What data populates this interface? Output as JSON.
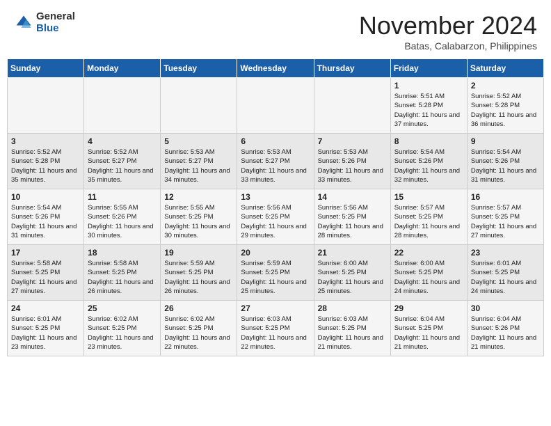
{
  "header": {
    "logo_general": "General",
    "logo_blue": "Blue",
    "month_title": "November 2024",
    "location": "Batas, Calabarzon, Philippines"
  },
  "weekdays": [
    "Sunday",
    "Monday",
    "Tuesday",
    "Wednesday",
    "Thursday",
    "Friday",
    "Saturday"
  ],
  "weeks": [
    [
      {
        "day": "",
        "sunrise": "",
        "sunset": "",
        "daylight": ""
      },
      {
        "day": "",
        "sunrise": "",
        "sunset": "",
        "daylight": ""
      },
      {
        "day": "",
        "sunrise": "",
        "sunset": "",
        "daylight": ""
      },
      {
        "day": "",
        "sunrise": "",
        "sunset": "",
        "daylight": ""
      },
      {
        "day": "",
        "sunrise": "",
        "sunset": "",
        "daylight": ""
      },
      {
        "day": "1",
        "sunrise": "Sunrise: 5:51 AM",
        "sunset": "Sunset: 5:28 PM",
        "daylight": "Daylight: 11 hours and 37 minutes."
      },
      {
        "day": "2",
        "sunrise": "Sunrise: 5:52 AM",
        "sunset": "Sunset: 5:28 PM",
        "daylight": "Daylight: 11 hours and 36 minutes."
      }
    ],
    [
      {
        "day": "3",
        "sunrise": "Sunrise: 5:52 AM",
        "sunset": "Sunset: 5:28 PM",
        "daylight": "Daylight: 11 hours and 35 minutes."
      },
      {
        "day": "4",
        "sunrise": "Sunrise: 5:52 AM",
        "sunset": "Sunset: 5:27 PM",
        "daylight": "Daylight: 11 hours and 35 minutes."
      },
      {
        "day": "5",
        "sunrise": "Sunrise: 5:53 AM",
        "sunset": "Sunset: 5:27 PM",
        "daylight": "Daylight: 11 hours and 34 minutes."
      },
      {
        "day": "6",
        "sunrise": "Sunrise: 5:53 AM",
        "sunset": "Sunset: 5:27 PM",
        "daylight": "Daylight: 11 hours and 33 minutes."
      },
      {
        "day": "7",
        "sunrise": "Sunrise: 5:53 AM",
        "sunset": "Sunset: 5:26 PM",
        "daylight": "Daylight: 11 hours and 33 minutes."
      },
      {
        "day": "8",
        "sunrise": "Sunrise: 5:54 AM",
        "sunset": "Sunset: 5:26 PM",
        "daylight": "Daylight: 11 hours and 32 minutes."
      },
      {
        "day": "9",
        "sunrise": "Sunrise: 5:54 AM",
        "sunset": "Sunset: 5:26 PM",
        "daylight": "Daylight: 11 hours and 31 minutes."
      }
    ],
    [
      {
        "day": "10",
        "sunrise": "Sunrise: 5:54 AM",
        "sunset": "Sunset: 5:26 PM",
        "daylight": "Daylight: 11 hours and 31 minutes."
      },
      {
        "day": "11",
        "sunrise": "Sunrise: 5:55 AM",
        "sunset": "Sunset: 5:26 PM",
        "daylight": "Daylight: 11 hours and 30 minutes."
      },
      {
        "day": "12",
        "sunrise": "Sunrise: 5:55 AM",
        "sunset": "Sunset: 5:25 PM",
        "daylight": "Daylight: 11 hours and 30 minutes."
      },
      {
        "day": "13",
        "sunrise": "Sunrise: 5:56 AM",
        "sunset": "Sunset: 5:25 PM",
        "daylight": "Daylight: 11 hours and 29 minutes."
      },
      {
        "day": "14",
        "sunrise": "Sunrise: 5:56 AM",
        "sunset": "Sunset: 5:25 PM",
        "daylight": "Daylight: 11 hours and 28 minutes."
      },
      {
        "day": "15",
        "sunrise": "Sunrise: 5:57 AM",
        "sunset": "Sunset: 5:25 PM",
        "daylight": "Daylight: 11 hours and 28 minutes."
      },
      {
        "day": "16",
        "sunrise": "Sunrise: 5:57 AM",
        "sunset": "Sunset: 5:25 PM",
        "daylight": "Daylight: 11 hours and 27 minutes."
      }
    ],
    [
      {
        "day": "17",
        "sunrise": "Sunrise: 5:58 AM",
        "sunset": "Sunset: 5:25 PM",
        "daylight": "Daylight: 11 hours and 27 minutes."
      },
      {
        "day": "18",
        "sunrise": "Sunrise: 5:58 AM",
        "sunset": "Sunset: 5:25 PM",
        "daylight": "Daylight: 11 hours and 26 minutes."
      },
      {
        "day": "19",
        "sunrise": "Sunrise: 5:59 AM",
        "sunset": "Sunset: 5:25 PM",
        "daylight": "Daylight: 11 hours and 26 minutes."
      },
      {
        "day": "20",
        "sunrise": "Sunrise: 5:59 AM",
        "sunset": "Sunset: 5:25 PM",
        "daylight": "Daylight: 11 hours and 25 minutes."
      },
      {
        "day": "21",
        "sunrise": "Sunrise: 6:00 AM",
        "sunset": "Sunset: 5:25 PM",
        "daylight": "Daylight: 11 hours and 25 minutes."
      },
      {
        "day": "22",
        "sunrise": "Sunrise: 6:00 AM",
        "sunset": "Sunset: 5:25 PM",
        "daylight": "Daylight: 11 hours and 24 minutes."
      },
      {
        "day": "23",
        "sunrise": "Sunrise: 6:01 AM",
        "sunset": "Sunset: 5:25 PM",
        "daylight": "Daylight: 11 hours and 24 minutes."
      }
    ],
    [
      {
        "day": "24",
        "sunrise": "Sunrise: 6:01 AM",
        "sunset": "Sunset: 5:25 PM",
        "daylight": "Daylight: 11 hours and 23 minutes."
      },
      {
        "day": "25",
        "sunrise": "Sunrise: 6:02 AM",
        "sunset": "Sunset: 5:25 PM",
        "daylight": "Daylight: 11 hours and 23 minutes."
      },
      {
        "day": "26",
        "sunrise": "Sunrise: 6:02 AM",
        "sunset": "Sunset: 5:25 PM",
        "daylight": "Daylight: 11 hours and 22 minutes."
      },
      {
        "day": "27",
        "sunrise": "Sunrise: 6:03 AM",
        "sunset": "Sunset: 5:25 PM",
        "daylight": "Daylight: 11 hours and 22 minutes."
      },
      {
        "day": "28",
        "sunrise": "Sunrise: 6:03 AM",
        "sunset": "Sunset: 5:25 PM",
        "daylight": "Daylight: 11 hours and 21 minutes."
      },
      {
        "day": "29",
        "sunrise": "Sunrise: 6:04 AM",
        "sunset": "Sunset: 5:25 PM",
        "daylight": "Daylight: 11 hours and 21 minutes."
      },
      {
        "day": "30",
        "sunrise": "Sunrise: 6:04 AM",
        "sunset": "Sunset: 5:26 PM",
        "daylight": "Daylight: 11 hours and 21 minutes."
      }
    ]
  ]
}
